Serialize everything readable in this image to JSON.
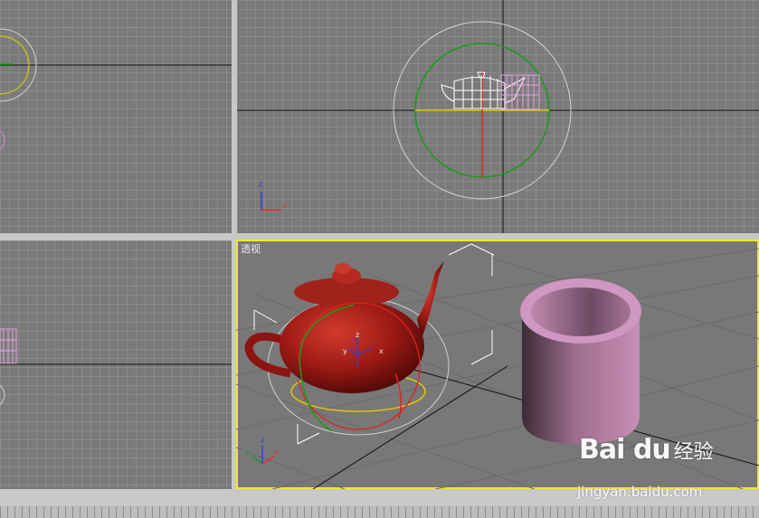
{
  "viewports": {
    "top_left": {
      "name": ""
    },
    "top_right": {
      "name": "",
      "axis": {
        "vertical": "z",
        "horizontal": "x"
      }
    },
    "bottom_left": {
      "name": ""
    },
    "perspective": {
      "name": "透视",
      "axis": {
        "vertical": "z",
        "left": "y",
        "right": "x"
      },
      "gizmo": {
        "vertical": "z",
        "left": "y",
        "right": "x"
      }
    }
  },
  "colors": {
    "grid_bg": "#7a7a7a",
    "active_border": "#f3e826",
    "teapot": "#9c1a14",
    "cup": "#c88fb6"
  },
  "watermark": {
    "brand": "Bai du",
    "sub": "经验",
    "url": "jingyan.baidu.com"
  }
}
